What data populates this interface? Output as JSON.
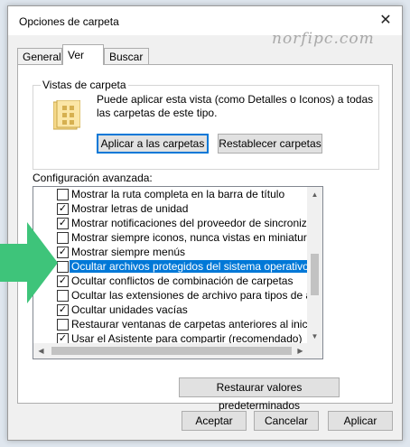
{
  "window": {
    "title": "Opciones de carpeta",
    "close_glyph": "✕"
  },
  "watermark": "norfipc.com",
  "tabs": [
    {
      "label": "General",
      "active": false
    },
    {
      "label": "Ver",
      "active": true
    },
    {
      "label": "Buscar",
      "active": false
    }
  ],
  "folder_views": {
    "legend": "Vistas de carpeta",
    "description": "Puede aplicar esta vista (como Detalles o Iconos) a todas las carpetas de este tipo.",
    "apply_button": "Aplicar a las carpetas",
    "reset_button": "Restablecer carpetas",
    "icon": "folder-icon"
  },
  "advanced": {
    "label": "Configuración avanzada:",
    "items": [
      {
        "label": "Mostrar la ruta completa en la barra de título",
        "checked": false
      },
      {
        "label": "Mostrar letras de unidad",
        "checked": true
      },
      {
        "label": "Mostrar notificaciones del proveedor de sincronización",
        "checked": true
      },
      {
        "label": "Mostrar siempre iconos, nunca vistas en miniatura",
        "checked": false
      },
      {
        "label": "Mostrar siempre menús",
        "checked": true
      },
      {
        "label": "Ocultar archivos protegidos del sistema operativo (recomendado)",
        "checked": false,
        "selected": true
      },
      {
        "label": "Ocultar conflictos de combinación de carpetas",
        "checked": true
      },
      {
        "label": "Ocultar las extensiones de archivo para tipos de archivo conocidos",
        "checked": false
      },
      {
        "label": "Ocultar unidades vacías",
        "checked": true
      },
      {
        "label": "Restaurar ventanas de carpetas anteriores al iniciar sesión",
        "checked": false
      },
      {
        "label": "Usar el Asistente para compartir (recomendado)",
        "checked": true
      }
    ],
    "check_glyph": "✓",
    "restore_button": "Restaurar valores predeterminados"
  },
  "footer": {
    "ok": "Aceptar",
    "cancel": "Cancelar",
    "apply": "Aplicar"
  },
  "colors": {
    "selection": "#0078d7",
    "arrow": "#3ec47a"
  }
}
